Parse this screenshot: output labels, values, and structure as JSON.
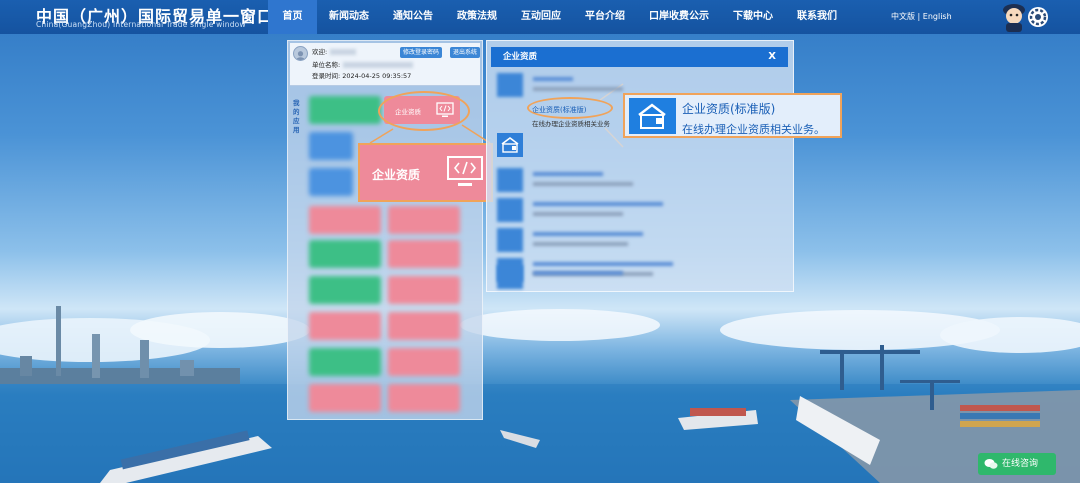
{
  "header": {
    "title": "中国（广州）国际贸易单一窗口",
    "subtitle": "China(GuangZhou) International Trade single window",
    "nav": [
      {
        "label": "首页",
        "active": true
      },
      {
        "label": "新闻动态"
      },
      {
        "label": "通知公告"
      },
      {
        "label": "政策法规"
      },
      {
        "label": "互动回应"
      },
      {
        "label": "平台介绍"
      },
      {
        "label": "口岸收费公示"
      },
      {
        "label": "下载中心"
      },
      {
        "label": "联系我们"
      }
    ],
    "language": "中文版 | English"
  },
  "user_panel": {
    "welcome_label": "欢迎:",
    "unit_label": "单位名称:",
    "login_time": "登录时间: 2024-04-25 09:35:57",
    "change_password_button": "修改登录密码",
    "logout_button": "退出系统",
    "my_apps_label": "我的应用"
  },
  "app_tiles": {
    "highlighted_label": "企业资质"
  },
  "left_callout": {
    "label": "企业资质"
  },
  "qualification_panel": {
    "title": "企业资质",
    "close_label": "X",
    "highlighted_item": {
      "title": "企业资质(标准版)",
      "description": "在线办理企业资质相关业务"
    }
  },
  "right_callout": {
    "title": "企业资质(标准版)",
    "description": "在线办理企业资质相关业务。"
  },
  "chat": {
    "label": "在线咨询"
  },
  "colors": {
    "header_blue": "#1553a0",
    "active_tab": "#2f76cf",
    "highlight_orange": "#f0a35a",
    "tile_pink": "#ee8a9a",
    "tile_green": "#3dbf86",
    "tile_blue": "#4c93e0",
    "chat_green": "#2fb86c"
  }
}
